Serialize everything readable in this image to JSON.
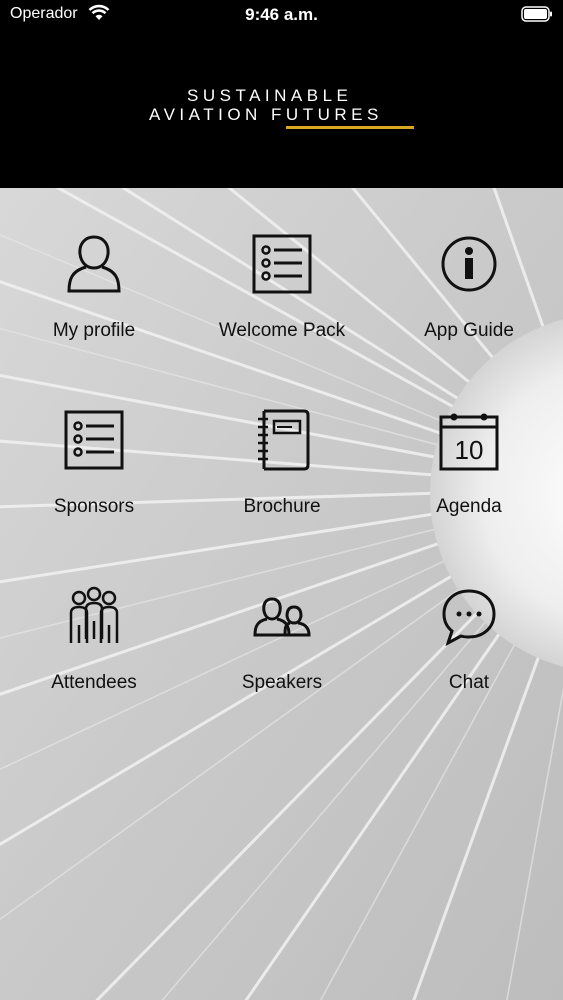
{
  "status_bar": {
    "carrier": "Operador",
    "time": "9:46 a.m."
  },
  "header": {
    "logo_line1": "SUSTAINABLE",
    "logo_line2": "AVIATION FUTURES",
    "accent_color": "#d9a821"
  },
  "menu": {
    "items": [
      {
        "label": "My profile",
        "icon": "person-icon"
      },
      {
        "label": "Welcome Pack",
        "icon": "list-icon"
      },
      {
        "label": "App Guide",
        "icon": "info-icon"
      },
      {
        "label": "Sponsors",
        "icon": "list-icon"
      },
      {
        "label": "Brochure",
        "icon": "notebook-icon"
      },
      {
        "label": "Agenda",
        "icon": "calendar-icon"
      },
      {
        "label": "Attendees",
        "icon": "group-icon"
      },
      {
        "label": "Speakers",
        "icon": "people-icon"
      },
      {
        "label": "Chat",
        "icon": "chat-bubble-icon"
      }
    ],
    "agenda_day": "10"
  }
}
